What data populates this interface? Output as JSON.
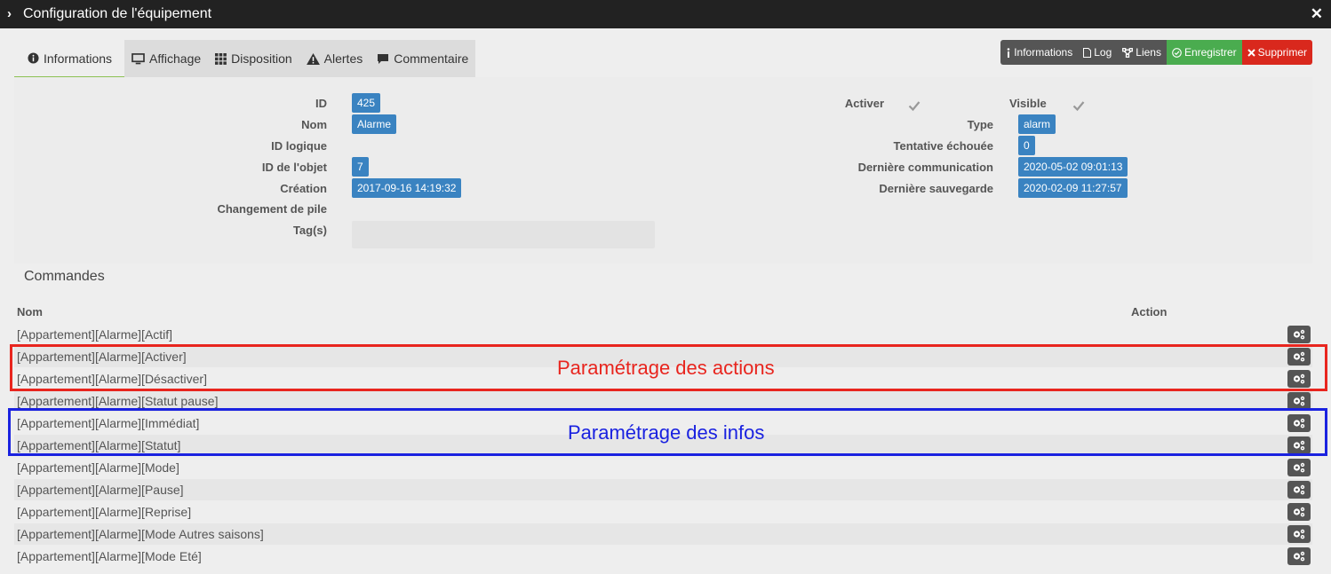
{
  "window": {
    "title": "Configuration de l'équipement"
  },
  "tabs": [
    {
      "label": "Informations",
      "icon": "info-circle-icon"
    },
    {
      "label": "Affichage",
      "icon": "monitor-icon"
    },
    {
      "label": "Disposition",
      "icon": "grid-icon"
    },
    {
      "label": "Alertes",
      "icon": "warning-icon"
    },
    {
      "label": "Commentaire",
      "icon": "comment-icon"
    }
  ],
  "toolbar": {
    "informations": "Informations",
    "log": "Log",
    "liens": "Liens",
    "enregistrer": "Enregistrer",
    "supprimer": "Supprimer"
  },
  "info": {
    "id_label": "ID",
    "id_value": "425",
    "nom_label": "Nom",
    "nom_value": "Alarme",
    "logical_label": "ID logique",
    "objet_label": "ID de l'objet",
    "objet_value": "7",
    "creation_label": "Création",
    "creation_value": "2017-09-16 14:19:32",
    "pile_label": "Changement de pile",
    "tags_label": "Tag(s)",
    "activer_label": "Activer",
    "visible_label": "Visible",
    "type_label": "Type",
    "type_value": "alarm",
    "tentative_label": "Tentative échouée",
    "tentative_value": "0",
    "comm_label": "Dernière communication",
    "comm_value": "2020-05-02 09:01:13",
    "save_label": "Dernière sauvegarde",
    "save_value": "2020-02-09 11:27:57"
  },
  "commands": {
    "title": "Commandes",
    "col_nom": "Nom",
    "col_action": "Action",
    "rows": [
      "[Appartement][Alarme][Actif]",
      "[Appartement][Alarme][Activer]",
      "[Appartement][Alarme][Désactiver]",
      "[Appartement][Alarme][Statut pause]",
      "[Appartement][Alarme][Immédiat]",
      "[Appartement][Alarme][Statut]",
      "[Appartement][Alarme][Mode]",
      "[Appartement][Alarme][Pause]",
      "[Appartement][Alarme][Reprise]",
      "[Appartement][Alarme][Mode Autres saisons]",
      "[Appartement][Alarme][Mode Eté]"
    ]
  },
  "annotations": {
    "actions": "Paramétrage des actions",
    "infos": "Paramétrage des infos"
  },
  "colors": {
    "badge": "#3a83c1",
    "save": "#4aac4f",
    "delete": "#d9281d",
    "annot_red": "#e8251e",
    "annot_blue": "#1a22e0"
  }
}
